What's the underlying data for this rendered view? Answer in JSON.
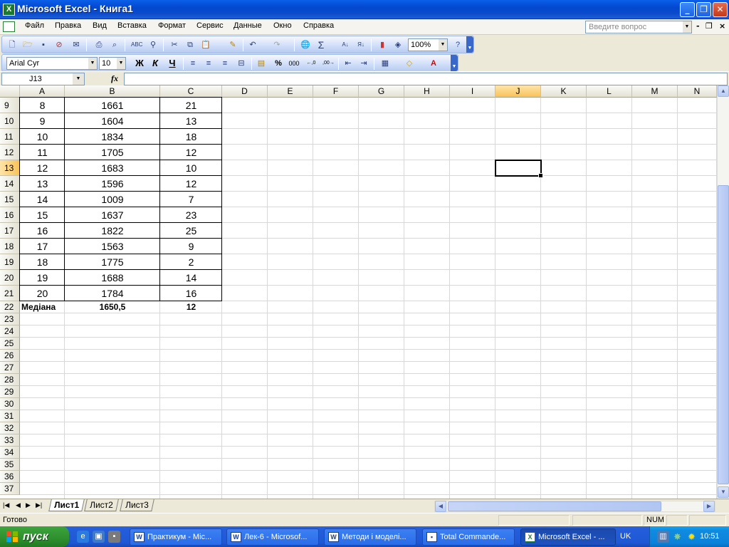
{
  "window": {
    "title": "Microsoft Excel - Книга1",
    "app_icon": "excel-icon",
    "buttons": [
      "minimize",
      "restore",
      "close"
    ]
  },
  "menu": {
    "items": [
      "Файл",
      "Правка",
      "Вид",
      "Вставка",
      "Формат",
      "Сервис",
      "Данные",
      "Окно",
      "Справка"
    ],
    "help_placeholder": "Введите вопрос"
  },
  "standard_toolbar": {
    "zoom": "100%",
    "icons": [
      "new-icon",
      "open-icon",
      "save-icon",
      "permission-icon",
      "email-icon",
      "print-icon",
      "print-preview-icon",
      "spelling-icon",
      "research-icon",
      "cut-icon",
      "copy-icon",
      "paste-icon",
      "format-painter-icon",
      "undo-icon",
      "redo-icon",
      "hyperlink-icon",
      "autosum-icon",
      "sort-ascending-icon",
      "sort-descending-icon",
      "chart-wizard-icon",
      "drawing-icon",
      "help-icon"
    ]
  },
  "formatting_toolbar": {
    "font": "Arial Cyr",
    "size": "10",
    "bold": "Ж",
    "italic": "К",
    "underline": "Ч",
    "icons": [
      "align-left-icon",
      "center-icon",
      "align-right-icon",
      "merge-center-icon",
      "currency-icon",
      "percent-icon",
      "comma-icon",
      "increase-decimal-icon",
      "decrease-decimal-icon",
      "decrease-indent-icon",
      "increase-indent-icon",
      "borders-icon",
      "fill-color-icon",
      "font-color-icon"
    ]
  },
  "formula_bar": {
    "name_box": "J13",
    "fx": "fx",
    "formula": ""
  },
  "columns": [
    "A",
    "B",
    "C",
    "D",
    "E",
    "F",
    "G",
    "H",
    "I",
    "J",
    "K",
    "L",
    "M",
    "N"
  ],
  "selected_column": "J",
  "selected_row": "13",
  "rows": [
    {
      "n": "9",
      "a": "8",
      "b": "1661",
      "c": "21"
    },
    {
      "n": "10",
      "a": "9",
      "b": "1604",
      "c": "13"
    },
    {
      "n": "11",
      "a": "10",
      "b": "1834",
      "c": "18"
    },
    {
      "n": "12",
      "a": "11",
      "b": "1705",
      "c": "12"
    },
    {
      "n": "13",
      "a": "12",
      "b": "1683",
      "c": "10"
    },
    {
      "n": "14",
      "a": "13",
      "b": "1596",
      "c": "12"
    },
    {
      "n": "15",
      "a": "14",
      "b": "1009",
      "c": "7"
    },
    {
      "n": "16",
      "a": "15",
      "b": "1637",
      "c": "23"
    },
    {
      "n": "17",
      "a": "16",
      "b": "1822",
      "c": "25"
    },
    {
      "n": "18",
      "a": "17",
      "b": "1563",
      "c": "9"
    },
    {
      "n": "19",
      "a": "18",
      "b": "1775",
      "c": "2"
    },
    {
      "n": "20",
      "a": "19",
      "b": "1688",
      "c": "14"
    },
    {
      "n": "21",
      "a": "20",
      "b": "1784",
      "c": "16"
    }
  ],
  "summary_row": {
    "n": "22",
    "a": "Медіана",
    "b": "1650,5",
    "c": "12"
  },
  "empty_rows": [
    "23",
    "24",
    "25",
    "26",
    "27",
    "28",
    "29",
    "30",
    "31",
    "32",
    "33",
    "34",
    "35",
    "36",
    "37"
  ],
  "sheets": [
    "Лист1",
    "Лист2",
    "Лист3"
  ],
  "active_sheet": "Лист1",
  "status": {
    "ready": "Готово",
    "num": "NUM"
  },
  "taskbar": {
    "start": "пуск",
    "tasks": [
      {
        "label": "Практикум - Mic...",
        "icon": "word-icon",
        "active": false
      },
      {
        "label": "Лек-6 - Microsof...",
        "icon": "word-icon",
        "active": false
      },
      {
        "label": "Методи і моделі...",
        "icon": "word-icon",
        "active": false
      },
      {
        "label": "Total Commande...",
        "icon": "floppy-icon",
        "active": false
      },
      {
        "label": "Microsoft Excel - ...",
        "icon": "excel-icon",
        "active": true
      }
    ],
    "lang": "UK",
    "clock": "10:51"
  }
}
